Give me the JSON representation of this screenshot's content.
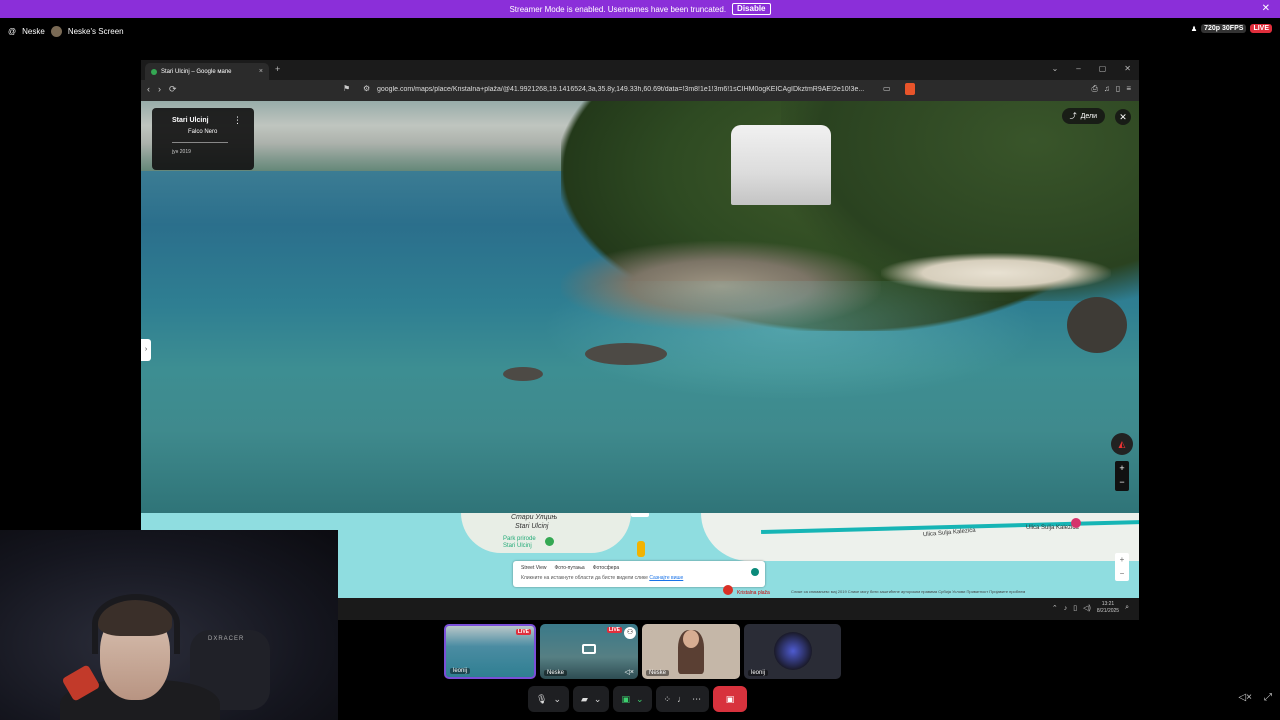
{
  "banner": {
    "message": "Streamer Mode is enabled. Usernames have been truncated.",
    "disable_label": "Disable",
    "close": "✕"
  },
  "header": {
    "at_icon": "@",
    "user": "Neske",
    "screen_title": "Neske's Screen",
    "quality": "720p 30FPS",
    "live": "LIVE"
  },
  "browser": {
    "tab_title": "Stari Ulcinj – Google мапе",
    "tab_close": "×",
    "new_tab": "+",
    "window_controls": [
      "⌄",
      "–",
      "▢",
      "✕"
    ],
    "nav": [
      "‹",
      "›",
      "⟳"
    ],
    "url": "google.com/maps/place/Kristalna+plaža/@41.9921268,19.1416524,3a,35.8y,149.33h,60.69t/data=!3m8!1e1!3m6!1sCIHM0ogKEICAgIDkztmR9AE!2e10!3e...",
    "right_icons": [
      "⎙",
      "♫",
      "▯",
      "≡"
    ]
  },
  "streetview": {
    "place": "Stari Ulcinj",
    "author": "Falco Nero",
    "date": "јун 2019",
    "kebab": "⋮",
    "share_label": "Дели",
    "close": "✕",
    "zoom_in": "+",
    "zoom_out": "−",
    "handle": "›"
  },
  "minimap": {
    "label_cyr": "Стари Улцињ",
    "label_lat": "Stari Ulcinj",
    "park_label": "Park prirode Stari Ulcinj",
    "street1": "Ulica Sulja Kalezića",
    "street2": "Ulica Sulja Kalezića",
    "legend": [
      "Street View",
      "Фото-путања",
      "Фотосфера"
    ],
    "hint": "Кликните на истакнуте области да бисте видели слике",
    "hint_link": "Сазнајте више",
    "zoom_in": "+",
    "zoom_out": "−",
    "pin_label": "Kristalna plaža",
    "attribution": "Слике са снимањем: мај 2019     Слике могу бити заштићене ауторским правима     Србија     Услови     Приватност     Пријавите проблем"
  },
  "taskbar": {
    "time": "13:21",
    "date": "8/21/2025"
  },
  "webcam": {
    "chair_brand": "DXRACER"
  },
  "participants": [
    {
      "name": "leonij",
      "live": "LIVE"
    },
    {
      "name": "Neske",
      "live": "LIVE"
    },
    {
      "name": "Neske"
    },
    {
      "name": "leonij"
    }
  ],
  "colors": {
    "banner": "#8b2fd9",
    "live": "#e02e3c",
    "end_call": "#d8323d",
    "share_green": "#3ccf6e"
  }
}
